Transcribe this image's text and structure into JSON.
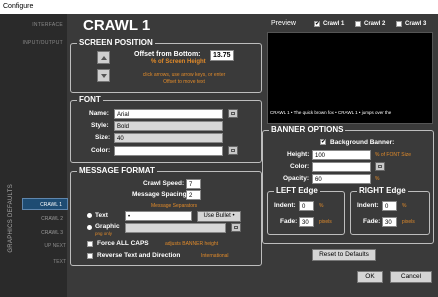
{
  "window": {
    "title": "Configure"
  },
  "sidebar": {
    "nav_top": [
      "INTERFACE",
      "INPUT/OUTPUT"
    ],
    "vertical_label": "GRAPHICS DEFAULTS",
    "crawl_tabs": [
      "CRAWL 1",
      "CRAWL 2",
      "CRAWL 3"
    ],
    "active_tab_index": 0,
    "other_items": [
      "UP NEXT",
      "TEXT"
    ]
  },
  "main": {
    "title": "CRAWL 1"
  },
  "screen_position": {
    "title": "SCREEN POSITION",
    "offset_label": "Offset from Bottom:",
    "offset_value": "13.75",
    "offset_unit": "% of Screen Height",
    "hint": "click arrows, use arrow keys, or enter Offset to move text"
  },
  "font": {
    "title": "FONT",
    "name_label": "Name:",
    "name_value": "Arial",
    "style_label": "Style:",
    "style_value": "Bold",
    "size_label": "Size:",
    "size_value": "40",
    "color_label": "Color:",
    "color_value": ""
  },
  "message_format": {
    "title": "MESSAGE FORMAT",
    "crawl_speed_label": "Crawl Speed:",
    "crawl_speed_value": "7",
    "spacing_label": "Message Spacing:",
    "spacing_value": "2",
    "separators_label": "Message Separators",
    "text_radio_label": "Text",
    "text_separator_value": "•",
    "use_bullet_label": "Use Bullet •",
    "graphic_radio_label": "Graphic",
    "graphic_note": "png only",
    "force_caps_label": "Force ALL CAPS",
    "force_caps_note": "adjusts BANNER height",
    "reverse_label": "Reverse Text and Direction",
    "reverse_note": "International"
  },
  "preview": {
    "label": "Preview",
    "checks": [
      {
        "label": "Crawl 1",
        "checked": true
      },
      {
        "label": "Crawl 2",
        "checked": false
      },
      {
        "label": "Crawl 3",
        "checked": false
      }
    ],
    "crawl_text": "CRAWL 1   •   The quick brown fox   •   CRAWL 1   •   jumps over the"
  },
  "banner_options": {
    "title": "BANNER OPTIONS",
    "background_label": "Background Banner:",
    "background_checked": true,
    "height_label": "Height:",
    "height_value": "100",
    "height_unit": "% of FONT Size",
    "color_label": "Color:",
    "opacity_label": "Opacity:",
    "opacity_value": "60",
    "opacity_unit": "%",
    "left_edge": {
      "title": "LEFT Edge",
      "indent_label": "Indent:",
      "indent_value": "0",
      "indent_unit": "%",
      "fade_label": "Fade:",
      "fade_value": "30",
      "fade_unit": "pixels"
    },
    "right_edge": {
      "title": "RIGHT Edge",
      "indent_label": "Indent:",
      "indent_value": "0",
      "indent_unit": "%",
      "fade_label": "Fade:",
      "fade_value": "30",
      "fade_unit": "pixels"
    },
    "reset_label": "Reset to Defaults"
  },
  "footer": {
    "ok_label": "OK",
    "cancel_label": "Cancel"
  },
  "colors": {
    "accent_orange": "#e08a2a",
    "active_tab": "#1e4c73"
  }
}
